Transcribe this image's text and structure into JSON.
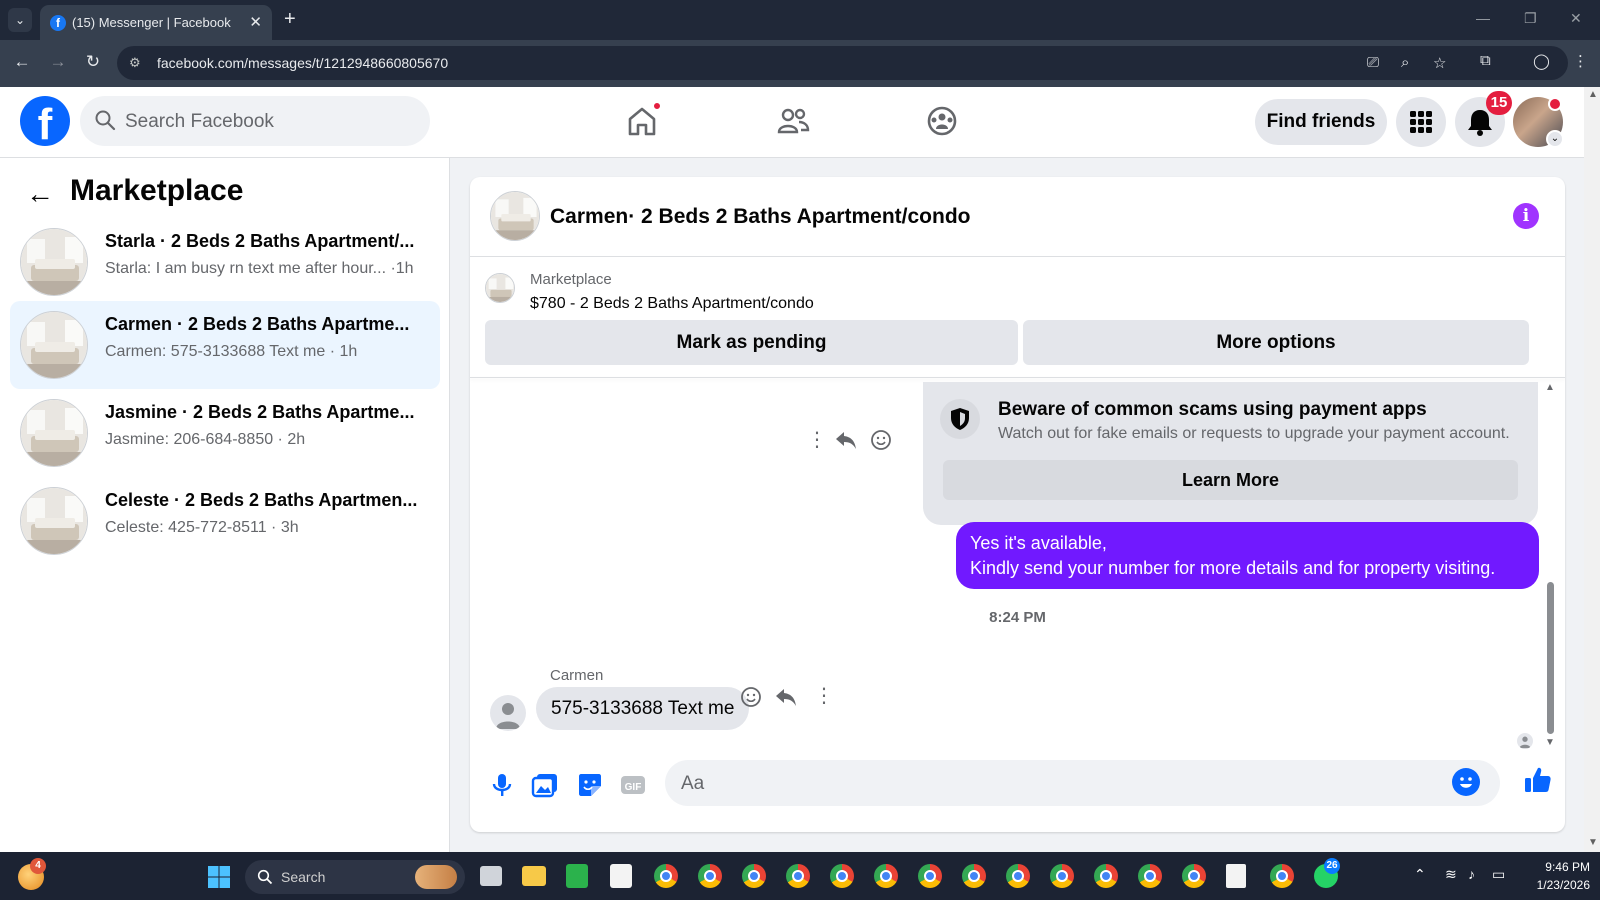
{
  "browser": {
    "tab_title": "(15) Messenger | Facebook",
    "url": "facebook.com/messages/t/1212948660805670"
  },
  "header": {
    "search_placeholder": "Search Facebook",
    "find_friends_label": "Find friends",
    "notification_count": "15"
  },
  "sidebar": {
    "title": "Marketplace",
    "conversations": [
      {
        "name": "Starla · 2 Beds 2 Baths Apartment/...",
        "snippet": "Starla: I am busy rn text me after hour... ·1h",
        "active": false
      },
      {
        "name": "Carmen · 2 Beds 2 Baths Apartme...",
        "snippet": "Carmen: 575-3133688 Text me · 1h",
        "active": true
      },
      {
        "name": "Jasmine · 2 Beds 2 Baths Apartme...",
        "snippet": "Jasmine: 206-684-8850 · 2h",
        "active": false
      },
      {
        "name": "Celeste · 2 Beds 2 Baths Apartmen...",
        "snippet": "Celeste: 425-772-8511 · 3h",
        "active": false
      }
    ]
  },
  "chat": {
    "title": "Carmen· 2 Beds 2 Baths Apartment/condo",
    "marketplace_label": "Marketplace",
    "listing": "$780 - 2 Beds 2 Baths Apartment/condo",
    "mark_pending_label": "Mark as pending",
    "more_options_label": "More options",
    "scam_notice": {
      "title": "Beware of common scams using payment apps",
      "body": "Watch out for fake emails or requests to upgrade your payment account.",
      "button": "Learn More"
    },
    "outgoing_message_line1": "Yes it's available,",
    "outgoing_message_line2": "Kindly send your number for more details and for property visiting.",
    "timestamp": "8:24 PM",
    "sender_name": "Carmen",
    "incoming_message": "575-3133688 Text me",
    "composer_placeholder": "Aa"
  },
  "taskbar": {
    "search_label": "Search",
    "time": "9:46 PM",
    "date": "1/23/2026",
    "weather_badge": "4",
    "whatsapp_badge": "26"
  },
  "colors": {
    "facebook_blue": "#0866ff",
    "messenger_purple": "#7119ff",
    "info_purple": "#a033ff",
    "notification_red": "#e41e3f"
  }
}
